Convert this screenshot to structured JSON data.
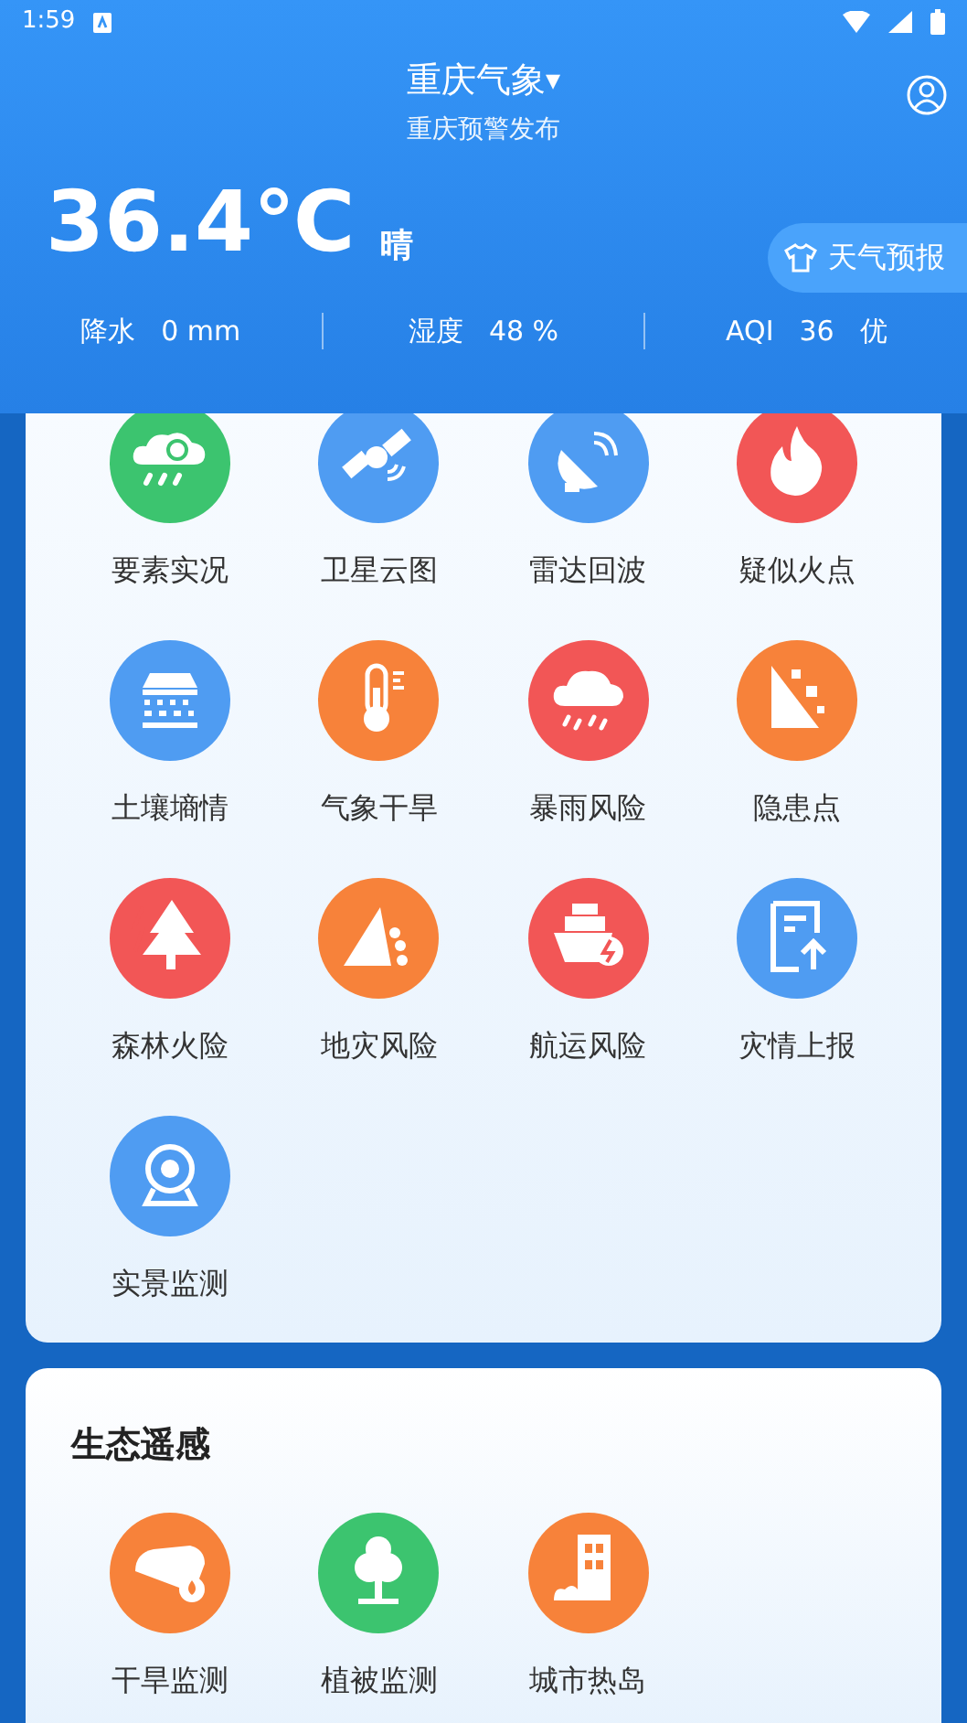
{
  "status_bar": {
    "time": "1:59"
  },
  "header": {
    "title": "重庆气象",
    "title_caret": "▾",
    "subtitle": "重庆预警发布"
  },
  "weather": {
    "temperature": "36.4℃",
    "condition": "晴",
    "forecast_button": "天气预报",
    "stats": [
      {
        "label": "降水",
        "value": "0 mm"
      },
      {
        "label": "湿度",
        "value": "48 %"
      },
      {
        "label": "AQI",
        "value": "36",
        "extra": "优"
      }
    ]
  },
  "services": {
    "items": [
      {
        "label": "要素实况",
        "color": "#3cc46f"
      },
      {
        "label": "卫星云图",
        "color": "#4f9cf2"
      },
      {
        "label": "雷达回波",
        "color": "#4f9cf2"
      },
      {
        "label": "疑似火点",
        "color": "#f25656"
      },
      {
        "label": "土壤墒情",
        "color": "#4f9cf2"
      },
      {
        "label": "气象干旱",
        "color": "#f7823a"
      },
      {
        "label": "暴雨风险",
        "color": "#f25656"
      },
      {
        "label": "隐患点",
        "color": "#f7823a"
      },
      {
        "label": "森林火险",
        "color": "#f25656"
      },
      {
        "label": "地灾风险",
        "color": "#f7823a"
      },
      {
        "label": "航运风险",
        "color": "#f25656"
      },
      {
        "label": "灾情上报",
        "color": "#4f9cf2"
      },
      {
        "label": "实景监测",
        "color": "#4f9cf2"
      }
    ]
  },
  "eco": {
    "title": "生态遥感",
    "items": [
      {
        "label": "干旱监测",
        "color": "#f7823a"
      },
      {
        "label": "植被监测",
        "color": "#3cc46f"
      },
      {
        "label": "城市热岛",
        "color": "#f7823a"
      }
    ]
  }
}
